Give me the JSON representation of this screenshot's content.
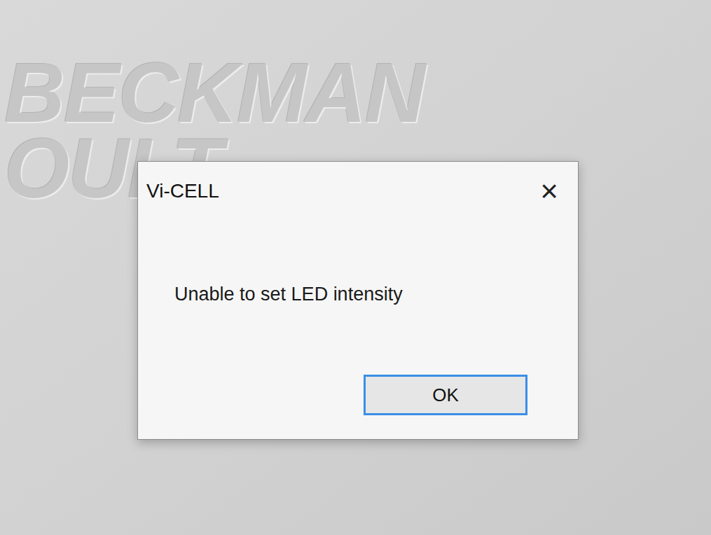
{
  "watermark": {
    "lines": [
      "BECKMAN",
      "OULT"
    ]
  },
  "dialog": {
    "title": "Vi-CELL",
    "close": "×",
    "message": "Unable to set LED intensity",
    "buttons": [
      {
        "label": "OK",
        "selected": true
      }
    ]
  }
}
